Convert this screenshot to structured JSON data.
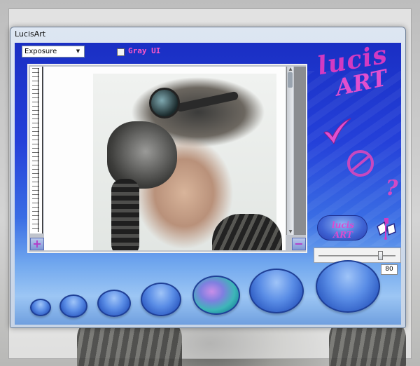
{
  "window": {
    "title": "LucisArt"
  },
  "controls": {
    "effect_select": {
      "value": "Exposure"
    },
    "gray_ui": {
      "label": "Gray UI",
      "checked": false
    }
  },
  "logo": {
    "line1": "lucis",
    "line2": "ART"
  },
  "actions": {
    "ok_icon": "check-icon",
    "cancel_icon": "cancel-icon",
    "help_label": "?",
    "lucis_button_label": "lucis ART"
  },
  "zoom": {
    "in_label": "+",
    "out_label": "−"
  },
  "slider": {
    "value": "80",
    "min": 0,
    "max": 100,
    "fraction": 0.8
  },
  "bubbles": {
    "count": 7,
    "active_index": 4
  },
  "colors": {
    "panel_blue": "#1a2fc4",
    "accent_pink": "#d23ac2",
    "gray_ui_label": "#ff58c8"
  }
}
